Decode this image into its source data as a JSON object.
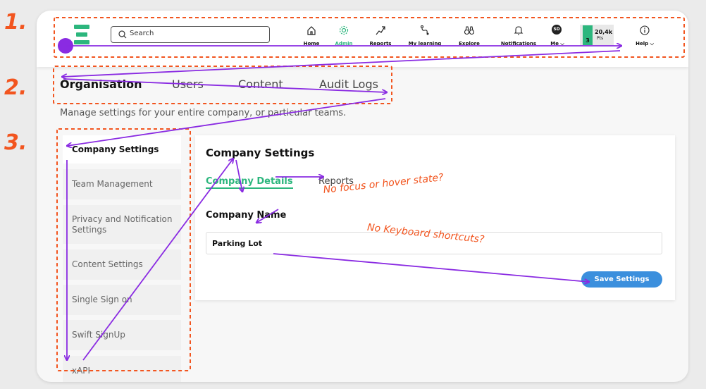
{
  "topbar": {
    "search_placeholder": "Search",
    "nav": [
      {
        "label": "Home",
        "icon": "home-icon"
      },
      {
        "label": "Admin",
        "icon": "gear-icon"
      },
      {
        "label": "Reports",
        "icon": "trend-up-icon"
      },
      {
        "label": "My learning",
        "icon": "path-icon"
      },
      {
        "label": "Explore",
        "icon": "binoculars-icon"
      },
      {
        "label": "Notifications",
        "icon": "bell-icon"
      },
      {
        "label": "Me ⌵",
        "avatar": "SD"
      },
      {
        "label": "Help ⌵",
        "icon": "info-icon"
      }
    ],
    "points": {
      "value": "20,4k",
      "unit": "Pts",
      "level": "3"
    },
    "accent": "#2cb67d"
  },
  "tabs": [
    "Organisation",
    "Users",
    "Content",
    "Audit Logs"
  ],
  "subtitle": "Manage settings for your entire company, or particular teams.",
  "sidebar": {
    "items": [
      {
        "label": "Company Settings"
      },
      {
        "label": "Team Management"
      },
      {
        "label": "Privacy and Notification Settings"
      },
      {
        "label": "Content Settings"
      },
      {
        "label": "Single Sign on"
      },
      {
        "label": "Swift SignUp"
      },
      {
        "label": "xAPI"
      }
    ]
  },
  "panel": {
    "title": "Company Settings",
    "tabs": [
      "Company Details",
      "Reports"
    ],
    "field_label": "Company Name",
    "field_value": "Parking Lot",
    "save_label": "Save Settings",
    "save_color": "#3b8fdd"
  },
  "annotations": {
    "steps": [
      "1.",
      "2.",
      "3."
    ],
    "notes": [
      "No focus or hover state?",
      "No Keyboard shortcuts?"
    ],
    "arrow_color": "#8a2be2",
    "box_color": "#f2551f"
  }
}
